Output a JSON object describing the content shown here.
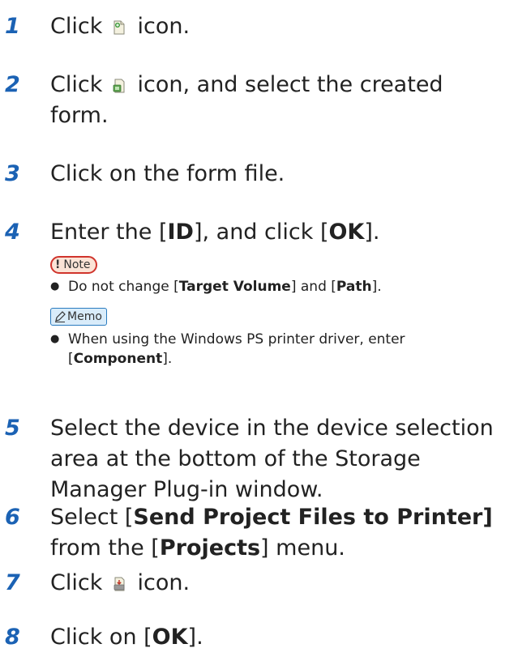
{
  "steps": [
    {
      "num": "1",
      "parts": [
        "Click ",
        "icon",
        " icon."
      ]
    },
    {
      "num": "2",
      "parts": [
        "Click ",
        "icon",
        " icon, and select the created"
      ],
      "line2": "form."
    },
    {
      "num": "3",
      "text": "Click on the form file."
    },
    {
      "num": "4",
      "pre": "Enter the [",
      "b1": "ID",
      "mid": "], and click [",
      "b2": "OK",
      "post": "]."
    },
    {
      "num": "5",
      "line1": "Select the device in the device selection",
      "line2": "area at the bottom of the Storage",
      "line3": "Manager Plug-in window."
    },
    {
      "num": "6",
      "pre": "Select [",
      "b1": "Send Project Files to Printer]",
      "line2_pre": "from the [",
      "b2": "Projects",
      "line2_post": "] menu."
    },
    {
      "num": "7",
      "pre": "Click ",
      "post": " icon."
    },
    {
      "num": "8",
      "pre": "Click on [",
      "b1": "OK",
      "post": "]."
    }
  ],
  "note": {
    "mark": "!",
    "label": "Note",
    "bullet_pre": "Do not change [",
    "b1": "Target Volume",
    "mid": "] and [",
    "b2": "Path",
    "post": "]."
  },
  "memo": {
    "label": "Memo",
    "bullet_line1": "When using the Windows PS printer driver, enter",
    "line2_pre": "[",
    "b1": "Component",
    "line2_post": "]."
  },
  "icons": {
    "step1": "new-form-icon",
    "step2": "open-form-icon",
    "step7": "send-to-printer-icon"
  },
  "colors": {
    "step_number": "#1b62b4",
    "note_border": "#d0342c",
    "note_fill": "#fbe3d6",
    "memo_border": "#2a7bbf",
    "memo_fill": "#d9ecfa"
  }
}
